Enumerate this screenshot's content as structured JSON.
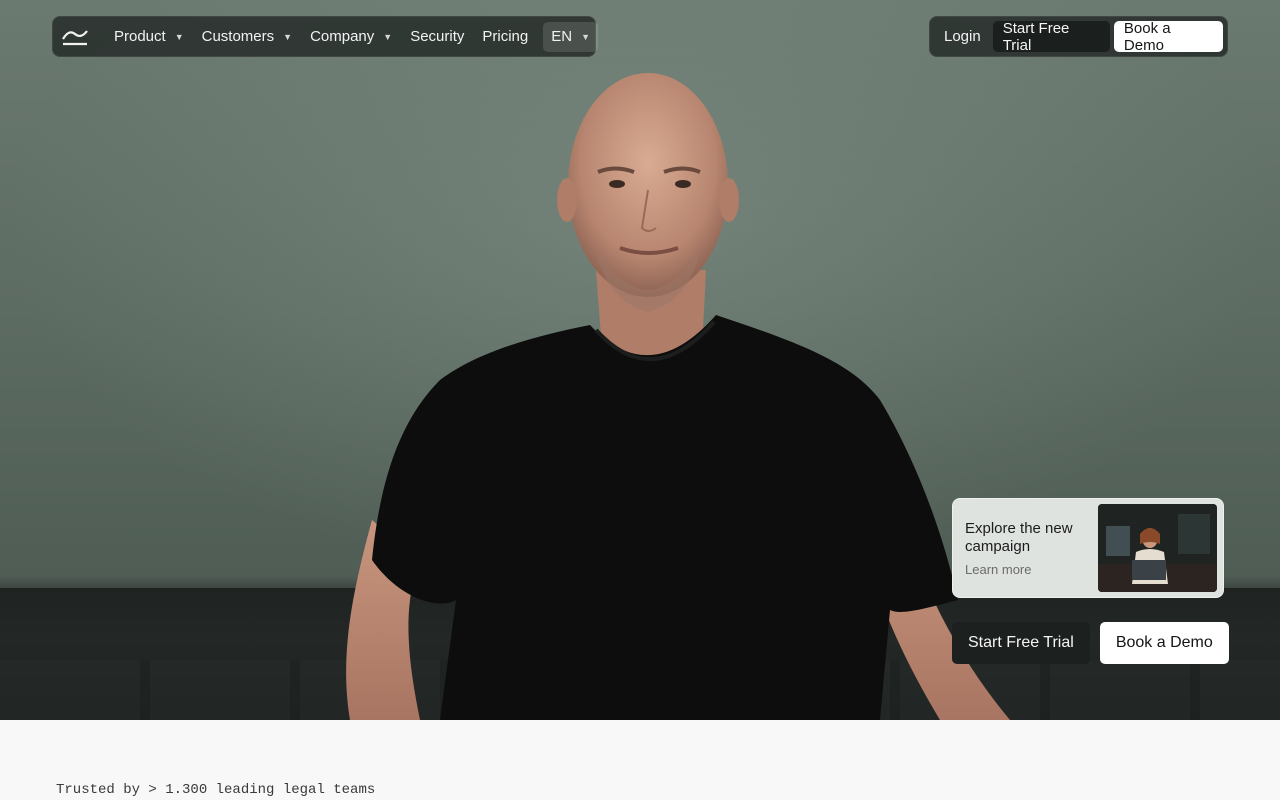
{
  "nav": {
    "logo_icon": "scale-wave-logo-icon",
    "items": [
      {
        "label": "Product",
        "has_dropdown": true
      },
      {
        "label": "Customers",
        "has_dropdown": true
      },
      {
        "label": "Company",
        "has_dropdown": true
      },
      {
        "label": "Security",
        "has_dropdown": false
      },
      {
        "label": "Pricing",
        "has_dropdown": false
      }
    ],
    "language": "EN",
    "login": "Login",
    "start_trial": "Start Free Trial",
    "book_demo": "Book a Demo"
  },
  "campaign": {
    "title": "Explore the new campaign",
    "link": "Learn more"
  },
  "hero_cta": {
    "start_trial": "Start Free Trial",
    "book_demo": "Book a Demo"
  },
  "trusted": "Trusted by > 1.300 leading legal teams",
  "colors": {
    "hero_bg": "#5c6b62",
    "nav_bg": "#262c29",
    "button_dark": "#1c201e",
    "button_light": "#ffffff",
    "page_bg": "#f8f8f8"
  }
}
